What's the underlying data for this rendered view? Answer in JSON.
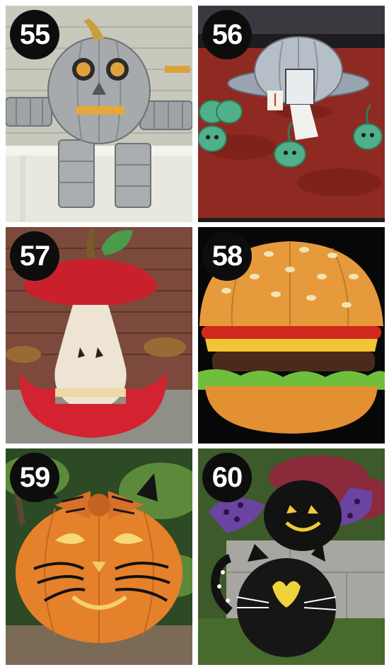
{
  "tiles": [
    {
      "number": "55",
      "subject": "robot pumpkin painted silver with metal duct arms and can legs"
    },
    {
      "number": "56",
      "subject": "silver flying saucer pumpkin with small green alien pumpkins"
    },
    {
      "number": "57",
      "subject": "apple core pumpkin with red skin and carved white core"
    },
    {
      "number": "58",
      "subject": "hamburger pumpkin with seeds, tomato, cheese, patty and lettuce"
    },
    {
      "number": "59",
      "subject": "cat jack-o-lantern with black whiskers and tiger-print bow"
    },
    {
      "number": "60",
      "subject": "black cat pumpkin and black bat pumpkin with purple wings"
    }
  ],
  "colors": {
    "badge_bg": "#0d0d0d",
    "badge_text": "#ffffff",
    "page_bg": "#ffffff"
  }
}
